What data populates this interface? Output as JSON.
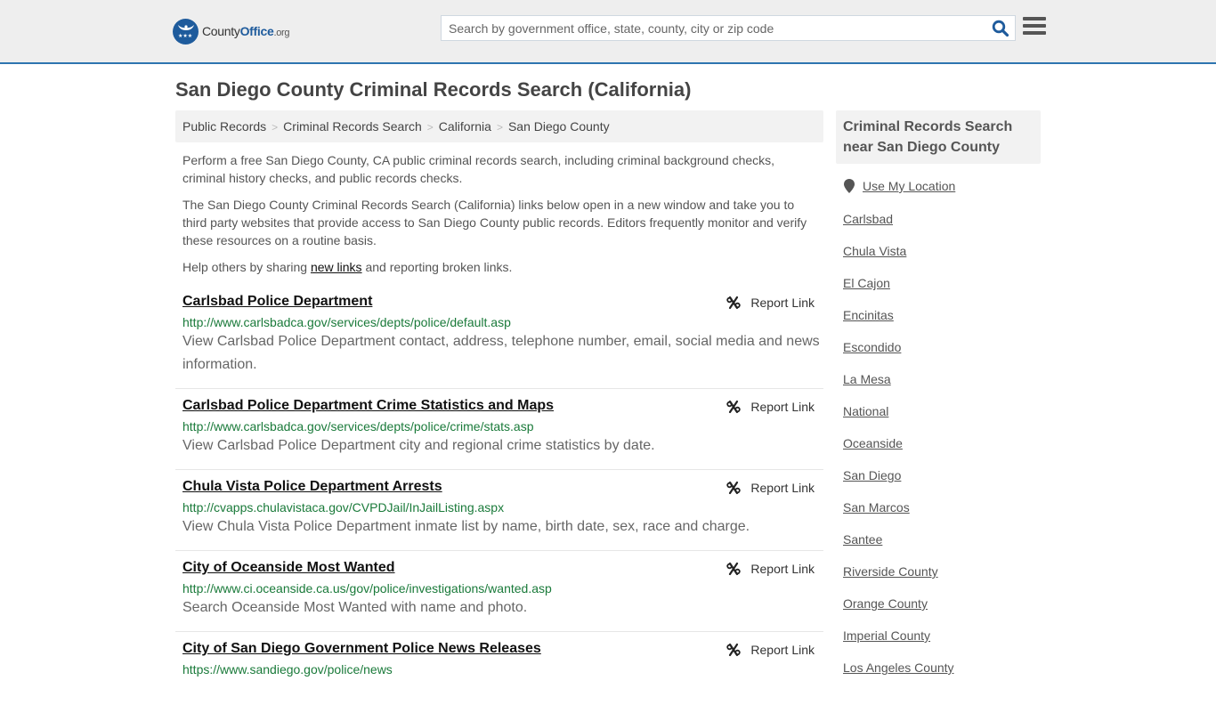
{
  "header": {
    "logo": {
      "brand_a": "County",
      "brand_b": "Office",
      "brand_tld": ".org"
    },
    "search": {
      "placeholder": "Search by government office, state, county, city or zip code",
      "value": ""
    },
    "icons": {
      "search": "search-icon",
      "menu": "hamburger-menu-icon"
    },
    "accent_color": "#2e75b0"
  },
  "page": {
    "title": "San Diego County Criminal Records Search (California)"
  },
  "breadcrumb": [
    {
      "label": "Public Records"
    },
    {
      "label": "Criminal Records Search"
    },
    {
      "label": "California"
    },
    {
      "label": "San Diego County"
    }
  ],
  "intro": {
    "p1": "Perform a free San Diego County, CA public criminal records search, including criminal background checks, criminal history checks, and public records checks.",
    "p2": "The San Diego County Criminal Records Search (California) links below open in a new window and take you to third party websites that provide access to San Diego County public records. Editors frequently monitor and verify these resources on a routine basis.",
    "p3_before": "Help others by sharing ",
    "p3_link": "new links",
    "p3_after": " and reporting broken links."
  },
  "results": [
    {
      "title": "Carlsbad Police Department",
      "url": "http://www.carlsbadca.gov/services/depts/police/default.asp",
      "description": "View Carlsbad Police Department contact, address, telephone number, email, social media and news information.",
      "report_label": "Report Link"
    },
    {
      "title": "Carlsbad Police Department Crime Statistics and Maps",
      "url": "http://www.carlsbadca.gov/services/depts/police/crime/stats.asp",
      "description": "View Carlsbad Police Department city and regional crime statistics by date.",
      "report_label": "Report Link"
    },
    {
      "title": "Chula Vista Police Department Arrests",
      "url": "http://cvapps.chulavistaca.gov/CVPDJail/InJailListing.aspx",
      "description": "View Chula Vista Police Department inmate list by name, birth date, sex, race and charge.",
      "report_label": "Report Link"
    },
    {
      "title": "City of Oceanside Most Wanted",
      "url": "http://www.ci.oceanside.ca.us/gov/police/investigations/wanted.asp",
      "description": "Search Oceanside Most Wanted with name and photo.",
      "report_label": "Report Link"
    },
    {
      "title": "City of San Diego Government Police News Releases",
      "url": "https://www.sandiego.gov/police/news",
      "description": "",
      "report_label": "Report Link"
    }
  ],
  "sidebar": {
    "heading": "Criminal Records Search near San Diego County",
    "use_location": "Use My Location",
    "links": [
      "Carlsbad",
      "Chula Vista",
      "El Cajon",
      "Encinitas",
      "Escondido",
      "La Mesa",
      "National",
      "Oceanside",
      "San Diego",
      "San Marcos",
      "Santee",
      "Riverside County",
      "Orange County",
      "Imperial County",
      "Los Angeles County"
    ]
  }
}
